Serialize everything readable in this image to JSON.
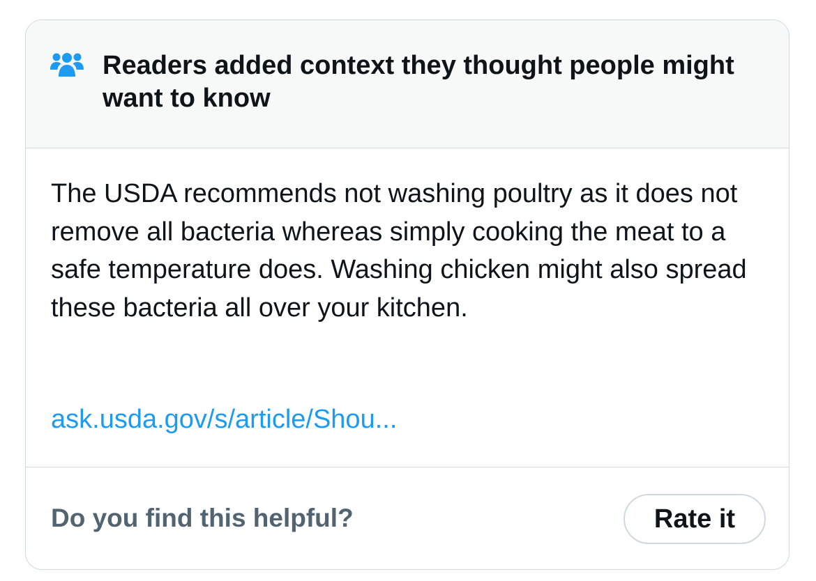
{
  "note": {
    "header_icon": "people-group-icon",
    "header_title": "Readers added context they thought people might want to know",
    "body_text": "The USDA recommends not washing poultry as it does not remove all bacteria whereas simply cooking the meat to a safe temperature does. Washing chicken might also spread these bacteria all over your kitchen.",
    "link_text": "ask.usda.gov/s/article/Shou...",
    "footer_question": "Do you find this helpful?",
    "rate_button_label": "Rate it"
  },
  "colors": {
    "accent": "#1d9bf0",
    "text_primary": "#0f1419",
    "text_secondary": "#536471",
    "border": "#cfd9de",
    "header_background": "#f7f9f9"
  }
}
